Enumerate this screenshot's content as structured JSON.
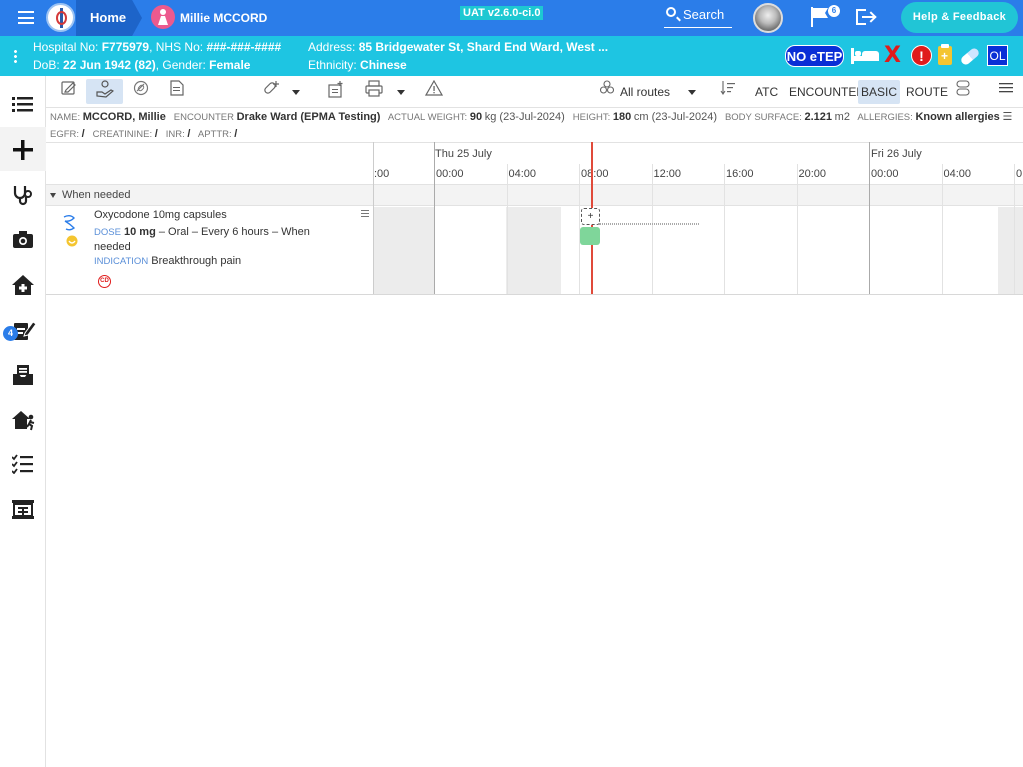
{
  "header": {
    "home_label": "Home",
    "patient_name": "Millie MCCORD",
    "version": "UAT v2.6.0-ci.0",
    "search_label": "Search",
    "flag_count": "6",
    "help_label": "Help & Feedback",
    "accent_color": "#2b7de9"
  },
  "patient_bar": {
    "hospital_no_label": "Hospital No:",
    "hospital_no": "F775979",
    "nhs_no_label": "NHS No:",
    "nhs_no": "###-###-####",
    "dob_label": "DoB:",
    "dob": "22 Jun 1942 (82)",
    "gender_label": "Gender:",
    "gender": "Female",
    "address_label": "Address:",
    "address": "85 Bridgewater St, Shard End Ward, West ...",
    "ethnicity_label": "Ethnicity:",
    "ethnicity": "Chinese",
    "no_etep": "NO eTEP",
    "alert_x": "X",
    "alert_excl": "!",
    "ol_badge": "OL",
    "bar_color": "#1ec5e2"
  },
  "sidebar": {
    "worklist_badge": "4"
  },
  "toolbar": {
    "routes_label": "All routes",
    "atc_label": "ATC",
    "encounter_label": "ENCOUNTER",
    "basic_label": "BASIC",
    "route_label": "ROUTE"
  },
  "info": {
    "name_label": "NAME:",
    "name": "MCCORD, Millie",
    "encounter_label": "ENCOUNTER",
    "encounter": "Drake Ward (EPMA Testing)",
    "weight_label": "ACTUAL WEIGHT:",
    "weight_value": "90",
    "weight_unit": "kg (23-Jul-2024)",
    "height_label": "HEIGHT:",
    "height_value": "180",
    "height_unit": "cm (23-Jul-2024)",
    "bsa_label": "BODY SURFACE:",
    "bsa_value": "2.121",
    "bsa_unit": "m2",
    "allergies_label": "ALLERGIES:",
    "allergies": "Known allergies",
    "egfr_label": "EGFR:",
    "egfr": "/",
    "creatinine_label": "CREATININE:",
    "creatinine": "/",
    "inr_label": "INR:",
    "inr": "/",
    "apttr_label": "APTTR:",
    "apttr": "/"
  },
  "timeline": {
    "dates": [
      "Thu 25 July",
      "Fri 26 July"
    ],
    "times": [
      ":00",
      "00:00",
      "04:00",
      "08:00",
      "12:00",
      "16:00",
      "20:00",
      "00:00",
      "04:00",
      "0"
    ]
  },
  "section": {
    "label": "When needed"
  },
  "medication": {
    "name": "Oxycodone 10mg capsules",
    "dose_label": "DOSE",
    "dose_value": "10 mg",
    "dose_detail": "– Oral – Every 6 hours – When needed",
    "indication_label": "INDICATION",
    "indication": "Breakthrough pain",
    "cd_badge": "CD",
    "add_symbol": "+"
  }
}
